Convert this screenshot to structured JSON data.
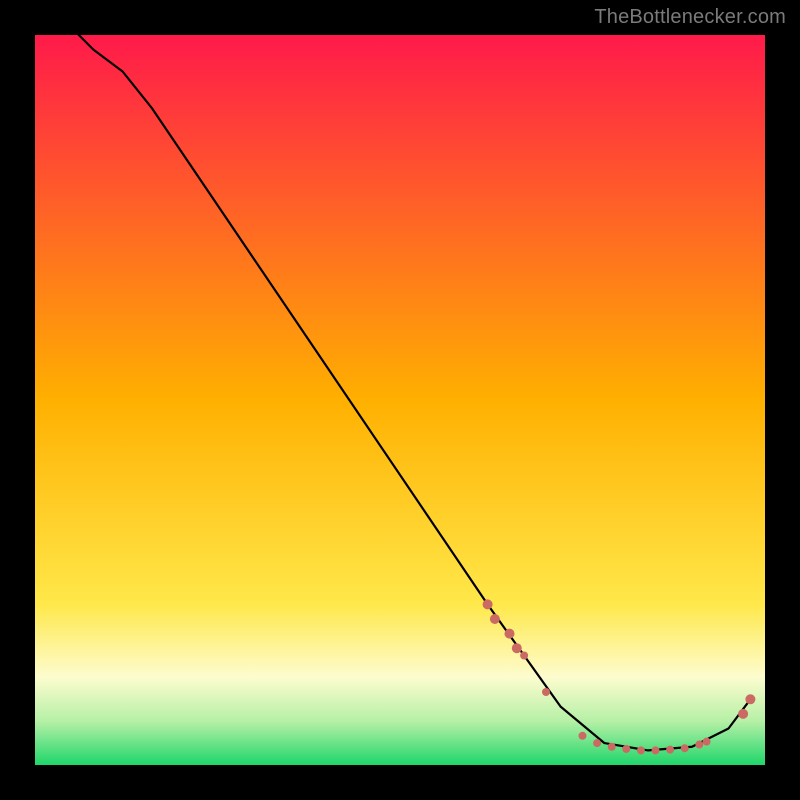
{
  "attribution": "TheBottlenecker.com",
  "colors": {
    "bg": "#000000",
    "attribution_text": "#7a7a7a",
    "curve_stroke": "#000000",
    "marker_fill": "#cb6a62",
    "gradient_stops": [
      {
        "offset": 0.0,
        "color": "#ff1a4a"
      },
      {
        "offset": 0.5,
        "color": "#ffb000"
      },
      {
        "offset": 0.78,
        "color": "#ffe84a"
      },
      {
        "offset": 0.88,
        "color": "#fdfccf"
      },
      {
        "offset": 0.94,
        "color": "#b6f0a6"
      },
      {
        "offset": 1.0,
        "color": "#1fd66a"
      }
    ]
  },
  "chart_data": {
    "type": "line",
    "title": "",
    "xlabel": "",
    "ylabel": "",
    "xlim": [
      0,
      100
    ],
    "ylim": [
      0,
      100
    ],
    "curve": [
      {
        "x": 6,
        "y": 100
      },
      {
        "x": 8,
        "y": 98
      },
      {
        "x": 12,
        "y": 95
      },
      {
        "x": 16,
        "y": 90
      },
      {
        "x": 62,
        "y": 22
      },
      {
        "x": 72,
        "y": 8
      },
      {
        "x": 78,
        "y": 3
      },
      {
        "x": 84,
        "y": 2
      },
      {
        "x": 90,
        "y": 2.5
      },
      {
        "x": 95,
        "y": 5
      },
      {
        "x": 98,
        "y": 9
      }
    ],
    "marker_clusters": [
      {
        "x": 62,
        "y": 22,
        "r": 5
      },
      {
        "x": 63,
        "y": 20,
        "r": 5
      },
      {
        "x": 65,
        "y": 18,
        "r": 5
      },
      {
        "x": 66,
        "y": 16,
        "r": 5
      },
      {
        "x": 67,
        "y": 15,
        "r": 4
      },
      {
        "x": 70,
        "y": 10,
        "r": 4
      },
      {
        "x": 75,
        "y": 4,
        "r": 4
      },
      {
        "x": 77,
        "y": 3,
        "r": 4
      },
      {
        "x": 79,
        "y": 2.5,
        "r": 4
      },
      {
        "x": 81,
        "y": 2.2,
        "r": 4
      },
      {
        "x": 83,
        "y": 2,
        "r": 4
      },
      {
        "x": 85,
        "y": 2,
        "r": 4
      },
      {
        "x": 87,
        "y": 2.1,
        "r": 4
      },
      {
        "x": 89,
        "y": 2.3,
        "r": 4
      },
      {
        "x": 91,
        "y": 2.8,
        "r": 4
      },
      {
        "x": 92,
        "y": 3.2,
        "r": 4
      },
      {
        "x": 97,
        "y": 7,
        "r": 5
      },
      {
        "x": 98,
        "y": 9,
        "r": 5
      }
    ]
  }
}
